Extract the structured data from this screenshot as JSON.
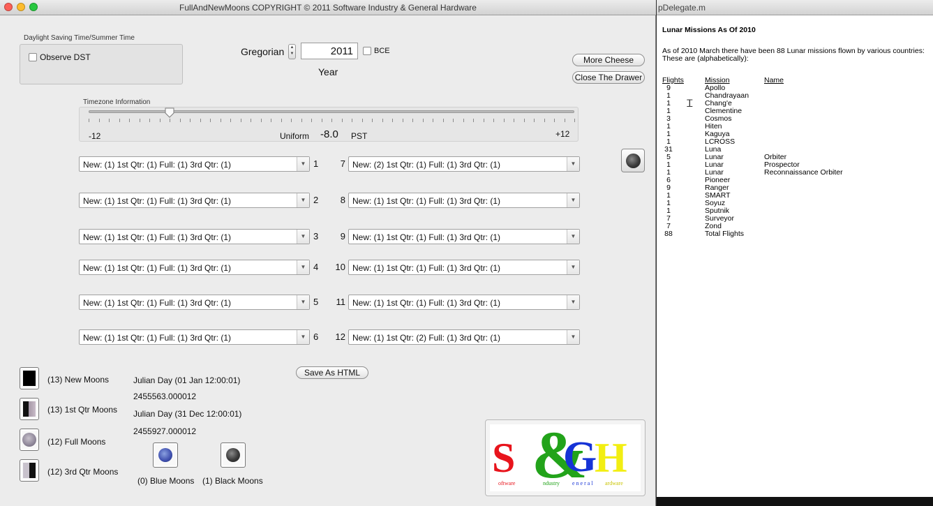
{
  "window": {
    "title": "FullAndNewMoons COPYRIGHT © 2011 Software Industry & General Hardware"
  },
  "dst": {
    "group_label": "Daylight Saving Time/Summer Time",
    "observe_label": "Observe DST"
  },
  "calendar": {
    "type": "Gregorian",
    "year": "2011",
    "bce_label": "BCE",
    "year_label": "Year"
  },
  "buttons": {
    "more_cheese": "More Cheese",
    "close_drawer": "Close The Drawer",
    "save_html": "Save As HTML"
  },
  "timezone": {
    "label": "Timezone Information",
    "min": "-12",
    "max": "+12",
    "mode": "Uniform",
    "value": "-8.0",
    "abbrev": "PST",
    "slider_value": -8,
    "slider_min": -12,
    "slider_max": 12
  },
  "months": [
    {
      "num": "1",
      "text": "New: (1) 1st Qtr: (1) Full: (1) 3rd Qtr: (1)"
    },
    {
      "num": "2",
      "text": "New: (1) 1st Qtr: (1) Full: (1) 3rd Qtr: (1)"
    },
    {
      "num": "3",
      "text": "New: (1) 1st Qtr: (1) Full: (1) 3rd Qtr: (1)"
    },
    {
      "num": "4",
      "text": "New: (1) 1st Qtr: (1) Full: (1) 3rd Qtr: (1)"
    },
    {
      "num": "5",
      "text": "New: (1) 1st Qtr: (1) Full: (1) 3rd Qtr: (1)"
    },
    {
      "num": "6",
      "text": "New: (1) 1st Qtr: (1) Full: (1) 3rd Qtr: (1)"
    },
    {
      "num": "7",
      "text": "New: (2) 1st Qtr: (1) Full: (1) 3rd Qtr: (1)"
    },
    {
      "num": "8",
      "text": "New: (1) 1st Qtr: (1) Full: (1) 3rd Qtr: (1)"
    },
    {
      "num": "9",
      "text": "New: (1) 1st Qtr: (1) Full: (1) 3rd Qtr: (1)"
    },
    {
      "num": "10",
      "text": "New: (1) 1st Qtr: (1) Full: (1) 3rd Qtr: (1)"
    },
    {
      "num": "11",
      "text": "New: (1) 1st Qtr: (1) Full: (1) 3rd Qtr: (1)"
    },
    {
      "num": "12",
      "text": "New: (1) 1st Qtr: (2) Full: (1) 3rd Qtr: (1)"
    }
  ],
  "phases": {
    "new": "(13) New Moons",
    "first": "(13) 1st Qtr Moons",
    "full": "(12) Full Moons",
    "third": "(12) 3rd Qtr Moons",
    "blue": "(0) Blue Moons",
    "black": "(1) Black Moons"
  },
  "julian": {
    "start_label": "Julian Day (01 Jan 12:00:01)",
    "start_value": "2455563.000012",
    "end_label": "Julian Day (31 Dec 12:00:01)",
    "end_value": "2455927.000012"
  },
  "logo": {
    "S": "S",
    "amp": "&",
    "G": "G",
    "H": "H",
    "w1": "oftware",
    "w2": "ndustry",
    "w3": "eneral",
    "w4": "ardware"
  },
  "editor": {
    "tab_title": "pDelegate.m",
    "heading": "Lunar Missions As Of 2010",
    "intro1": "As of 2010 March there have been 88 Lunar missions flown by various countries:",
    "intro2": "These are (alphabetically):",
    "col_flights": "Flights",
    "col_mission": "Mission",
    "col_name": "Name",
    "rows": [
      {
        "f": "9",
        "m": "Apollo",
        "n": ""
      },
      {
        "f": "1",
        "m": "Chandrayaan",
        "n": ""
      },
      {
        "f": "1",
        "m": "Chang'e",
        "n": ""
      },
      {
        "f": "1",
        "m": "Clementine",
        "n": ""
      },
      {
        "f": "3",
        "m": "Cosmos",
        "n": ""
      },
      {
        "f": "1",
        "m": "Hiten",
        "n": ""
      },
      {
        "f": "1",
        "m": "Kaguya",
        "n": ""
      },
      {
        "f": "1",
        "m": "LCROSS",
        "n": ""
      },
      {
        "f": "31",
        "m": "Luna",
        "n": ""
      },
      {
        "f": "5",
        "m": "Lunar",
        "n": "Orbiter"
      },
      {
        "f": "1",
        "m": "Lunar",
        "n": "Prospector"
      },
      {
        "f": "1",
        "m": "Lunar",
        "n": "Reconnaissance Orbiter"
      },
      {
        "f": "6",
        "m": "Pioneer",
        "n": ""
      },
      {
        "f": "9",
        "m": "Ranger",
        "n": ""
      },
      {
        "f": "1",
        "m": "SMART",
        "n": ""
      },
      {
        "f": "1",
        "m": "Soyuz",
        "n": ""
      },
      {
        "f": "1",
        "m": "Sputnik",
        "n": ""
      },
      {
        "f": "7",
        "m": "Surveyor",
        "n": ""
      },
      {
        "f": "7",
        "m": "Zond",
        "n": ""
      },
      {
        "f": "88",
        "m": "Total Flights",
        "n": ""
      }
    ]
  },
  "colors": {
    "logo_red": "#e8141c",
    "logo_green": "#22a31a",
    "logo_blue": "#1633d6",
    "logo_yellow": "#f2ee12"
  }
}
